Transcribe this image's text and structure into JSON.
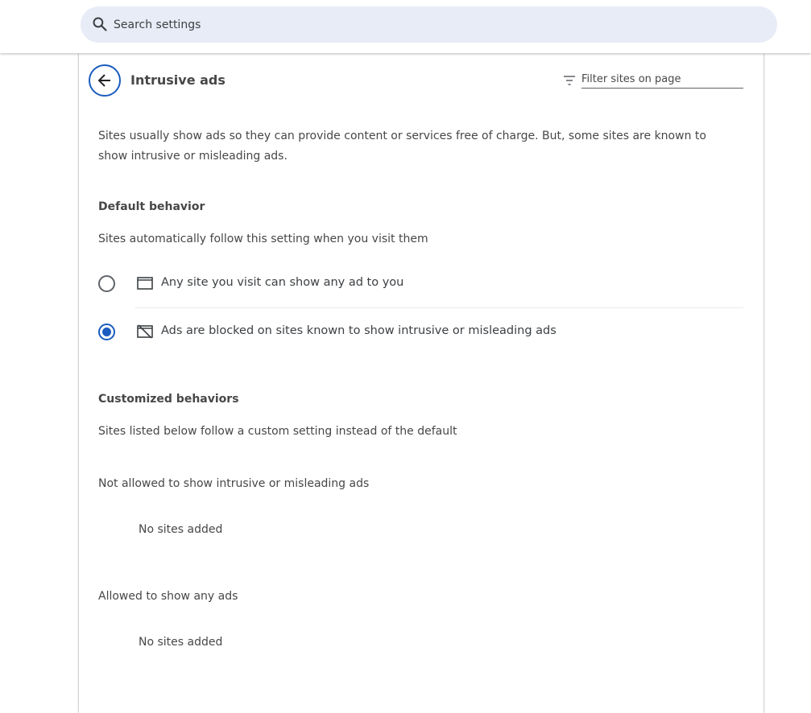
{
  "search": {
    "placeholder": "Search settings"
  },
  "header": {
    "title": "Intrusive ads",
    "filter_placeholder": "Filter sites on page"
  },
  "description": "Sites usually show ads so they can provide content or services free of charge. But, some sites are known to show intrusive or misleading ads.",
  "default_behavior": {
    "heading": "Default behavior",
    "subtitle": "Sites automatically follow this setting when you visit them",
    "options": [
      {
        "label": "Any site you visit can show any ad to you",
        "icon": "ad-window-icon",
        "selected": false
      },
      {
        "label": "Ads are blocked on sites known to show intrusive or misleading ads",
        "icon": "ad-blocked-icon",
        "selected": true
      }
    ]
  },
  "customized_behaviors": {
    "heading": "Customized behaviors",
    "subtitle": "Sites listed below follow a custom setting instead of the default",
    "lists": [
      {
        "label": "Not allowed to show intrusive or misleading ads",
        "empty_text": "No sites added"
      },
      {
        "label": "Allowed to show any ads",
        "empty_text": "No sites added"
      }
    ]
  },
  "colors": {
    "accent": "#1a5cbf",
    "search_bg": "#e8ecf6",
    "text": "#474747"
  }
}
